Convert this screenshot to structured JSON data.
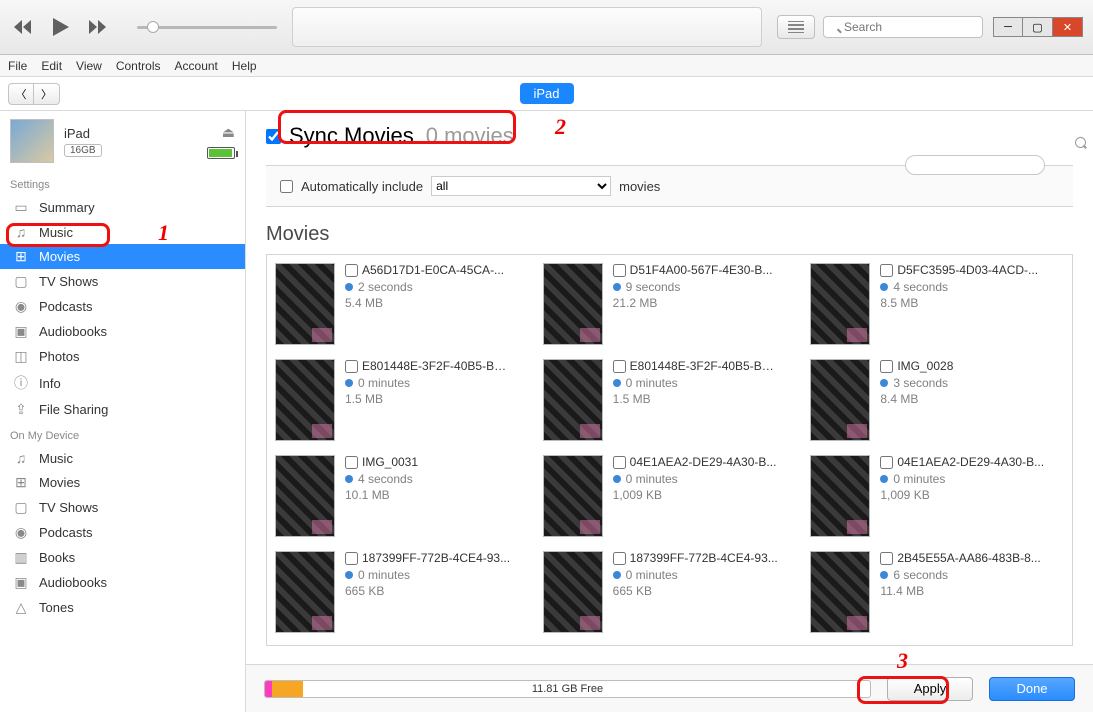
{
  "menubar": {
    "file": "File",
    "edit": "Edit",
    "view": "View",
    "controls": "Controls",
    "account": "Account",
    "help": "Help"
  },
  "search": {
    "placeholder": "Search"
  },
  "nav": {
    "pill": "iPad"
  },
  "device": {
    "name": "iPad",
    "capacity": "16GB"
  },
  "sidebar": {
    "settings_label": "Settings",
    "settings": [
      {
        "icon": "summary",
        "label": "Summary"
      },
      {
        "icon": "music",
        "label": "Music"
      },
      {
        "icon": "movies",
        "label": "Movies"
      },
      {
        "icon": "tv",
        "label": "TV Shows"
      },
      {
        "icon": "podcasts",
        "label": "Podcasts"
      },
      {
        "icon": "audiobooks",
        "label": "Audiobooks"
      },
      {
        "icon": "photos",
        "label": "Photos"
      },
      {
        "icon": "info",
        "label": "Info"
      },
      {
        "icon": "share",
        "label": "File Sharing"
      }
    ],
    "device_label": "On My Device",
    "ondevice": [
      {
        "icon": "music",
        "label": "Music"
      },
      {
        "icon": "movies",
        "label": "Movies"
      },
      {
        "icon": "tv",
        "label": "TV Shows"
      },
      {
        "icon": "podcasts",
        "label": "Podcasts"
      },
      {
        "icon": "books",
        "label": "Books"
      },
      {
        "icon": "audiobooks",
        "label": "Audiobooks"
      },
      {
        "icon": "tones",
        "label": "Tones"
      }
    ]
  },
  "sync": {
    "title": "Sync Movies",
    "count": "0 movies",
    "auto_label": "Automatically include",
    "auto_select": "all",
    "auto_suffix": "movies"
  },
  "section_title": "Movies",
  "movies": [
    {
      "name": "A56D17D1-E0CA-45CA-...",
      "dur": "2 seconds",
      "size": "5.4 MB"
    },
    {
      "name": "D51F4A00-567F-4E30-B...",
      "dur": "9 seconds",
      "size": "21.2 MB"
    },
    {
      "name": "D5FC3595-4D03-4ACD-...",
      "dur": "4 seconds",
      "size": "8.5 MB"
    },
    {
      "name": "E801448E-3F2F-40B5-BA...",
      "dur": "0 minutes",
      "size": "1.5 MB"
    },
    {
      "name": "E801448E-3F2F-40B5-BA...",
      "dur": "0 minutes",
      "size": "1.5 MB"
    },
    {
      "name": "IMG_0028",
      "dur": "3 seconds",
      "size": "8.4 MB"
    },
    {
      "name": "IMG_0031",
      "dur": "4 seconds",
      "size": "10.1 MB"
    },
    {
      "name": "04E1AEA2-DE29-4A30-B...",
      "dur": "0 minutes",
      "size": "1,009 KB"
    },
    {
      "name": "04E1AEA2-DE29-4A30-B...",
      "dur": "0 minutes",
      "size": "1,009 KB"
    },
    {
      "name": "187399FF-772B-4CE4-93...",
      "dur": "0 minutes",
      "size": "665 KB"
    },
    {
      "name": "187399FF-772B-4CE4-93...",
      "dur": "0 minutes",
      "size": "665 KB"
    },
    {
      "name": "2B45E55A-AA86-483B-8...",
      "dur": "6 seconds",
      "size": "11.4 MB"
    }
  ],
  "bottom": {
    "free": "11.81 GB Free",
    "apply": "Apply",
    "done": "Done"
  },
  "annotations": {
    "n1": "1",
    "n2": "2",
    "n3": "3"
  },
  "icons": {
    "summary": "▭",
    "music": "♫",
    "movies": "⊞",
    "tv": "▢",
    "podcasts": "◉",
    "audiobooks": "▣",
    "photos": "◫",
    "info": "ⓘ",
    "share": "⇪",
    "books": "▥",
    "tones": "△"
  }
}
